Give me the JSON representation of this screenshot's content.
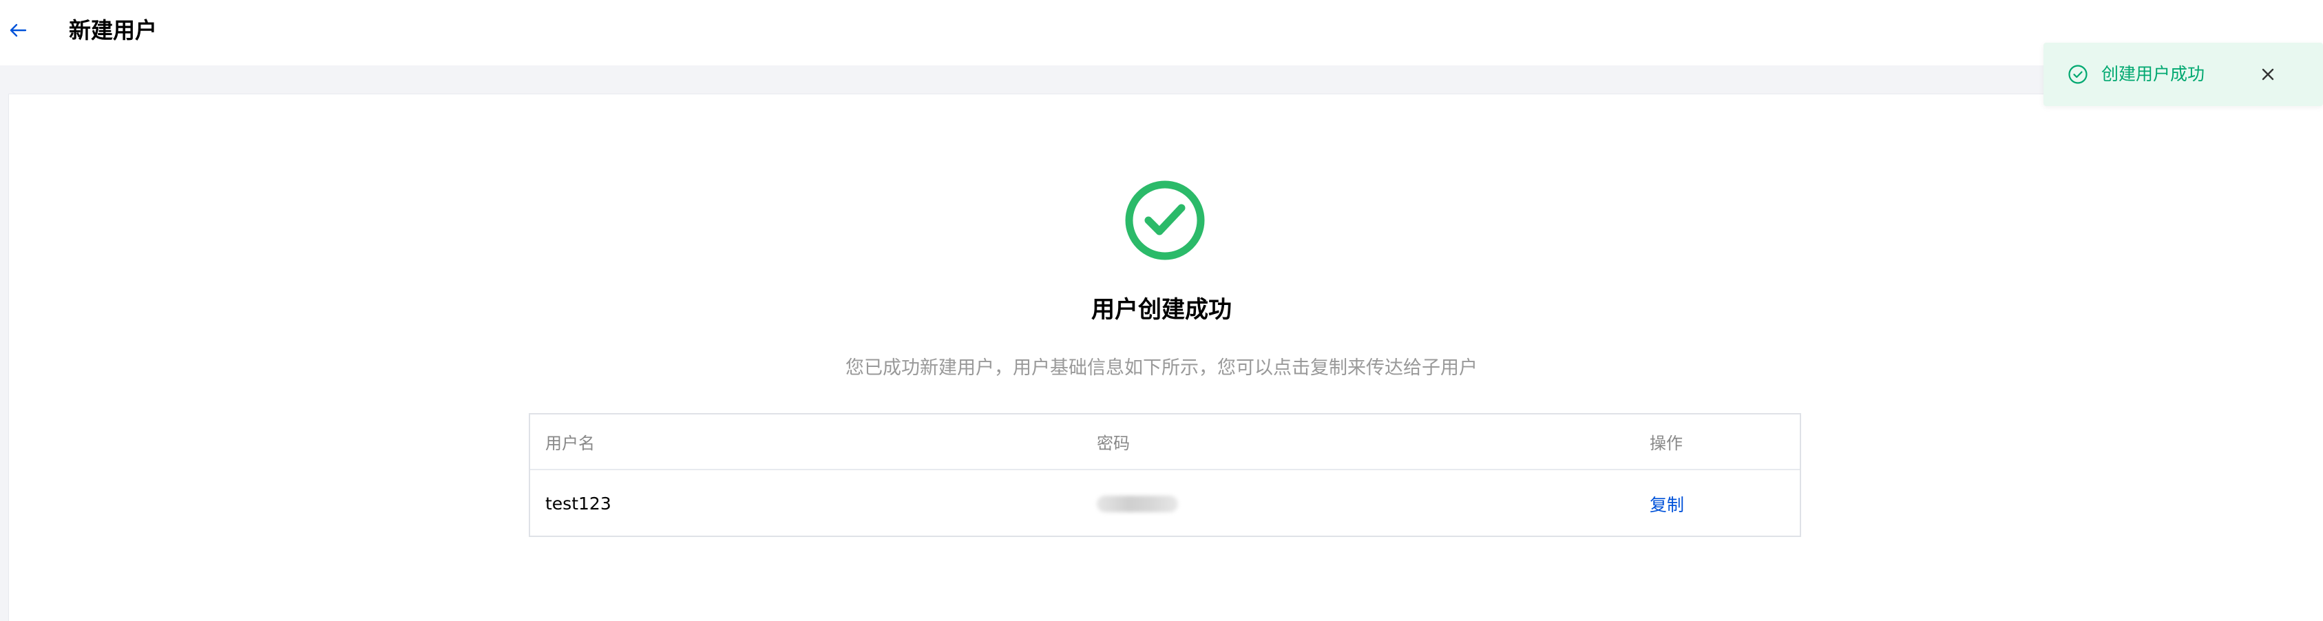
{
  "header": {
    "back_icon": "arrow-left-icon",
    "title": "新建用户"
  },
  "result": {
    "icon": "check-circle-icon",
    "title": "用户创建成功",
    "description": "您已成功新建用户，用户基础信息如下所示，您可以点击复制来传达给子用户"
  },
  "table": {
    "columns": [
      "用户名",
      "密码",
      "操作"
    ],
    "rows": [
      {
        "username": "test123",
        "password_masked": true,
        "action": "复制"
      }
    ]
  },
  "toast": {
    "icon": "check-circle-icon",
    "message": "创建用户成功",
    "close_icon": "close-icon"
  },
  "colors": {
    "accent": "#0052d9",
    "success": "#2bba69",
    "toast_bg": "#e8f8f0",
    "toast_text": "#00a870",
    "muted_text": "#999999",
    "page_bg": "#f3f4f7"
  }
}
